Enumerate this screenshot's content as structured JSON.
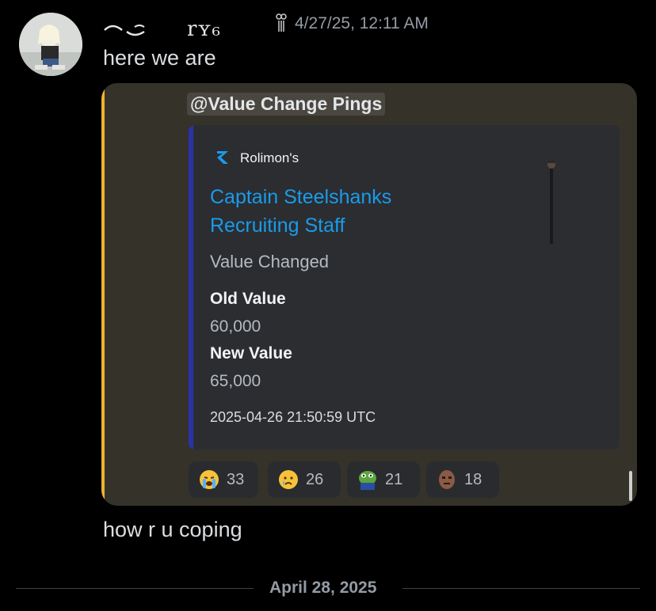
{
  "message1": {
    "author": "rʏ₆",
    "timestamp": "4/27/25, 12:11 AM",
    "text": "here we are"
  },
  "forwarded": {
    "mention": "@Value Change Pings",
    "embed": {
      "provider": "Rolimon's",
      "title": "Captain Steelshanks Recruiting Staff",
      "description": "Value Changed",
      "fields": [
        {
          "name": "Old Value",
          "value": "60,000"
        },
        {
          "name": "New Value",
          "value": "65,000"
        }
      ],
      "footer": "2025-04-26 21:50:59 UTC"
    },
    "reactions": [
      {
        "emoji": "loudly-crying-face",
        "count": "33"
      },
      {
        "emoji": "crying-face",
        "count": "26"
      },
      {
        "emoji": "pepe-frog",
        "count": "21"
      },
      {
        "emoji": "brown-mask",
        "count": "18"
      }
    ]
  },
  "message2": {
    "text": "how r u coping"
  },
  "divider": {
    "date": "April 28, 2025"
  },
  "colors": {
    "accent_quote": "#f0b232",
    "embed_bar": "#2b32a8",
    "link": "#1a9bea",
    "background": "#000000"
  }
}
